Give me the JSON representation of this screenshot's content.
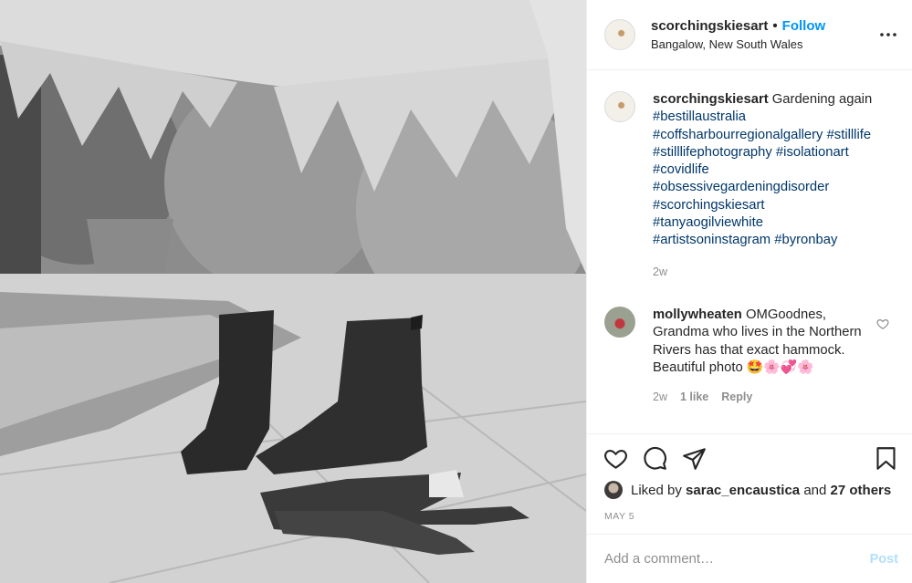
{
  "post": {
    "username": "scorchingskiesart",
    "separator": "•",
    "follow_label": "Follow",
    "location": "Bangalow, New South Wales",
    "more_icon": "more-horizontal-icon"
  },
  "caption": {
    "username": "scorchingskiesart",
    "text": "Gardening again",
    "hashtags": [
      "#bestillaustralia",
      "#coffsharbourregionalgallery",
      "#stilllife",
      "#stilllifephotography",
      "#isolationart",
      "#covidlife",
      "#obsessivegardeningdisorder",
      "#scorchingskiesart",
      "#tanyaogilviewhite",
      "#artistsoninstagram",
      "#byronbay"
    ],
    "time": "2w"
  },
  "comment": {
    "username": "mollywheaten",
    "text": "OMGoodnes, Grandma who lives in the Northern Rivers has that exact hammock. Beautiful photo 🤩🌸💞🌸",
    "time": "2w",
    "likes": "1 like",
    "reply_label": "Reply"
  },
  "actions": {
    "liked_prefix": "Liked by",
    "liked_user": "sarac_encaustica",
    "liked_and": "and",
    "liked_others": "27 others",
    "date": "MAY 5"
  },
  "add_comment": {
    "placeholder": "Add a comment…",
    "post_label": "Post"
  },
  "colors": {
    "link_blue": "#0095f6",
    "hashtag_blue": "#00376b",
    "muted": "#8e8e8e",
    "disabled_post": "#b2dffc"
  }
}
